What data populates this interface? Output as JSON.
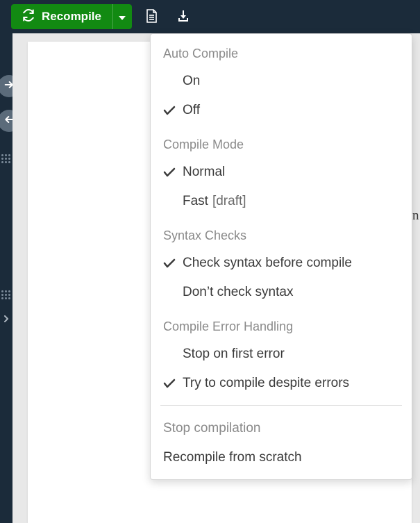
{
  "toolbar": {
    "recompile_label": "Recompile"
  },
  "dropdown": {
    "sections": [
      {
        "header": "Auto Compile",
        "items": [
          {
            "label": "On",
            "checked": false
          },
          {
            "label": "Off",
            "checked": true
          }
        ]
      },
      {
        "header": "Compile Mode",
        "items": [
          {
            "label": "Normal",
            "checked": true
          },
          {
            "label": "Fast",
            "suffix": "[draft]",
            "checked": false
          }
        ]
      },
      {
        "header": "Syntax Checks",
        "items": [
          {
            "label": "Check syntax before compile",
            "checked": true
          },
          {
            "label": "Don’t check syntax",
            "checked": false
          }
        ]
      },
      {
        "header": "Compile Error Handling",
        "items": [
          {
            "label": "Stop on first error",
            "checked": false
          },
          {
            "label": "Try to compile despite errors",
            "checked": true
          }
        ]
      }
    ],
    "actions": [
      {
        "label": "Stop compilation",
        "muted": true
      },
      {
        "label": "Recompile from scratch",
        "muted": false
      }
    ]
  },
  "background_text": "n"
}
